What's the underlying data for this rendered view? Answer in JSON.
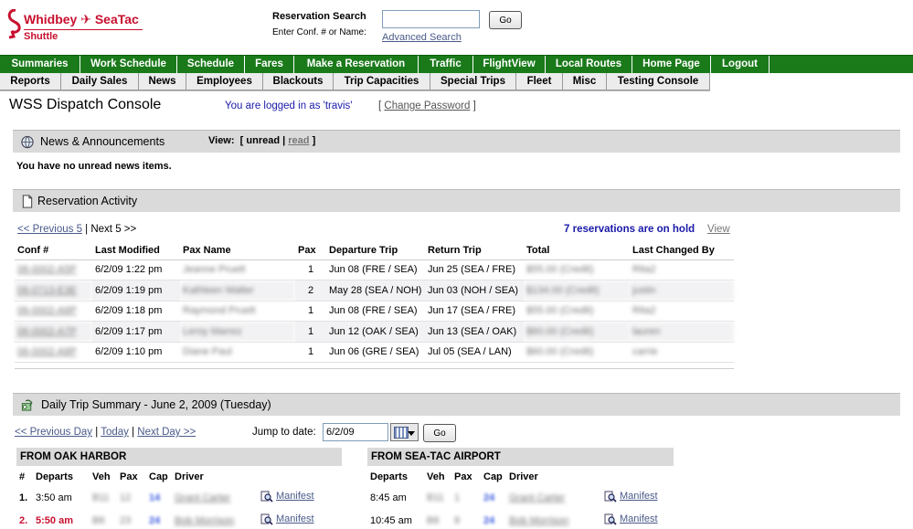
{
  "header": {
    "logo_line1": "Whidbey ✈ SeaTac",
    "logo_line2": "Shuttle",
    "search_title": "Reservation Search",
    "search_subtitle": "Enter Conf. # or Name:",
    "search_value": "",
    "search_button": "Go",
    "advanced_search": "Advanced Search"
  },
  "nav_primary": [
    {
      "label": "Summaries"
    },
    {
      "label": "Work Schedule"
    },
    {
      "label": "Schedule"
    },
    {
      "label": "Fares"
    },
    {
      "label": "Make a Reservation"
    },
    {
      "label": "Traffic"
    },
    {
      "label": "FlightView"
    },
    {
      "label": "Local Routes"
    },
    {
      "label": "Home Page"
    },
    {
      "label": "Logout"
    }
  ],
  "nav_secondary": [
    {
      "label": "Reports"
    },
    {
      "label": "Daily Sales"
    },
    {
      "label": "News"
    },
    {
      "label": "Employees"
    },
    {
      "label": "Blackouts"
    },
    {
      "label": "Trip Capacities"
    },
    {
      "label": "Special Trips"
    },
    {
      "label": "Fleet"
    },
    {
      "label": "Misc"
    },
    {
      "label": "Testing Console"
    }
  ],
  "console": {
    "title": "WSS Dispatch Console",
    "logged_in": "You are logged in as 'travis'",
    "change_password": "Change Password"
  },
  "news": {
    "title": "News & Announcements",
    "view_label": "View:",
    "view_unread": "unread",
    "view_read": "read",
    "empty_text": "You have no unread news items."
  },
  "reservations": {
    "title": "Reservation Activity",
    "prev": "<< Previous 5",
    "next": "Next 5 >>",
    "on_hold": "7 reservations are on hold",
    "view": "View",
    "columns": [
      "Conf #",
      "Last Modified",
      "Pax Name",
      "Pax",
      "Departure Trip",
      "Return Trip",
      "Total",
      "Last Changed By"
    ],
    "rows": [
      {
        "conf": "06-0002-A5P",
        "modified": "6/2/09 1:22 pm",
        "name": "Jeanne Pruett",
        "pax": "1",
        "dep": "Jun 08 (FRE / SEA)",
        "ret": "Jun 25 (SEA / FRE)",
        "total": "$55.00 (Credit)",
        "by": "Rita2"
      },
      {
        "conf": "06-0713-E3E",
        "modified": "6/2/09 1:19 pm",
        "name": "Kathleen Walter",
        "pax": "2",
        "dep": "May 28 (SEA / NOH)",
        "ret": "Jun 03 (NOH / SEA)",
        "total": "$134.00 (Credit)",
        "by": "justin"
      },
      {
        "conf": "06-0002-A6P",
        "modified": "6/2/09 1:18 pm",
        "name": "Raymond Pruett",
        "pax": "1",
        "dep": "Jun 08 (FRE / SEA)",
        "ret": "Jun 17 (SEA / FRE)",
        "total": "$55.00 (Credit)",
        "by": "Rita2"
      },
      {
        "conf": "06-0002-A7P",
        "modified": "6/2/09 1:17 pm",
        "name": "Leroy Marrez",
        "pax": "1",
        "dep": "Jun 12 (OAK / SEA)",
        "ret": "Jun 13 (SEA / OAK)",
        "total": "$60.00 (Credit)",
        "by": "lauren"
      },
      {
        "conf": "06-0002-A8P",
        "modified": "6/2/09 1:10 pm",
        "name": "Diane Paul",
        "pax": "1",
        "dep": "Jun 06 (GRE / SEA)",
        "ret": "Jul 05 (SEA / LAN)",
        "total": "$60.00 (Credit)",
        "by": "carrie"
      }
    ]
  },
  "trips": {
    "title": "Daily Trip Summary - June 2, 2009 (Tuesday)",
    "prev_day": "<< Previous Day",
    "today": "Today",
    "next_day": "Next Day >>",
    "jump_label": "Jump to date:",
    "jump_value": "6/2/09",
    "jump_button": "Go",
    "oak": {
      "heading": "FROM OAK HARBOR",
      "columns": [
        "#",
        "Departs",
        "Veh",
        "Pax",
        "Cap",
        "Driver"
      ],
      "rows": [
        {
          "num": "1.",
          "departs": "3:50 am",
          "veh": "B11",
          "pax": "12",
          "cap": "14",
          "driver": "Grant Carter",
          "manifest": "Manifest",
          "late": false
        },
        {
          "num": "2.",
          "departs": "5:50 am",
          "veh": "B8",
          "pax": "23",
          "cap": "24",
          "driver": "Bob Morrison",
          "manifest": "Manifest",
          "late": true
        }
      ]
    },
    "sea": {
      "heading": "FROM SEA-TAC AIRPORT",
      "columns": [
        "Departs",
        "Veh",
        "Pax",
        "Cap",
        "Driver"
      ],
      "rows": [
        {
          "departs": "8:45 am",
          "veh": "B11",
          "pax": "1",
          "cap": "24",
          "driver": "Grant Carter",
          "manifest": "Manifest"
        },
        {
          "departs": "10:45 am",
          "veh": "B8",
          "pax": "8",
          "cap": "24",
          "driver": "Bob Morrison",
          "manifest": "Manifest"
        }
      ]
    }
  },
  "colors": {
    "brand_red": "#c8102e",
    "nav_green": "#1a7a1a",
    "section_gray": "#dadada",
    "link_blue": "#1a1aaa"
  }
}
